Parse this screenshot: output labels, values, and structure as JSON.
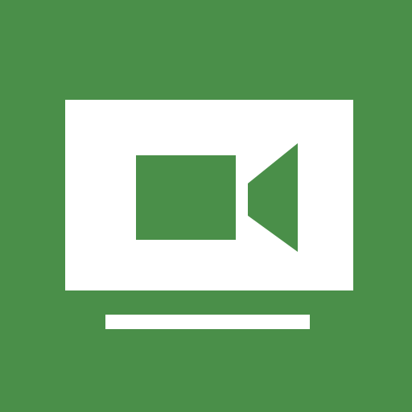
{
  "icon": {
    "name": "video-camera-screen-icon",
    "colors": {
      "background": "#4a8f49",
      "foreground": "#ffffff",
      "camera": "#4a8f49"
    }
  }
}
